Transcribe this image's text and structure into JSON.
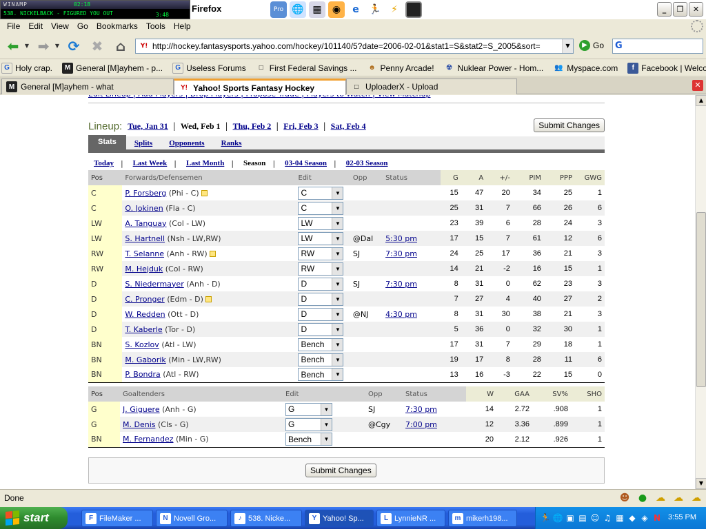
{
  "winamp": {
    "title": "WINAMP",
    "track": "538. NICKELBACK - FIGURED YOU OUT",
    "elapsed": "02:18",
    "length": "3:48"
  },
  "window": {
    "title": "Firefox"
  },
  "menu": [
    "File",
    "Edit",
    "View",
    "Go",
    "Bookmarks",
    "Tools",
    "Help"
  ],
  "nav": {
    "url": "http://hockey.fantasysports.yahoo.com/hockey/101140/5?date=2006-02-01&stat1=S&stat2=S_2005&sort=",
    "go_label": "Go"
  },
  "bookmarks": [
    {
      "label": "Holy crap.",
      "icon": "G"
    },
    {
      "label": "General [M]ayhem - p...",
      "icon": "M"
    },
    {
      "label": "Useless Forums",
      "icon": "G"
    },
    {
      "label": "First Federal Savings ...",
      "icon": "□"
    },
    {
      "label": "Penny Arcade!",
      "icon": "☻"
    },
    {
      "label": "Nuklear Power - Hom...",
      "icon": "☢"
    },
    {
      "label": "Myspace.com",
      "icon": "👥"
    },
    {
      "label": "Facebook | Welcome ...",
      "icon": "f"
    }
  ],
  "tabs": [
    {
      "label": "General [M]ayhem - what",
      "icon": "M"
    },
    {
      "label": "Yahoo! Sports Fantasy Hockey",
      "icon": "Y!"
    },
    {
      "label": "UploaderX - Upload",
      "icon": "□"
    }
  ],
  "page": {
    "top_links": "Edit Lineup  |  Add Players  |  Drop Players  |  Propose Trade  |  Players to Watch  |  View Matchup",
    "lineup_label": "Lineup:",
    "dates": [
      {
        "label": "Tue, Jan 31",
        "current": false
      },
      {
        "label": "Wed, Feb 1",
        "current": true
      },
      {
        "label": "Thu, Feb 2",
        "current": false
      },
      {
        "label": "Fri, Feb 3",
        "current": false
      },
      {
        "label": "Sat, Feb 4",
        "current": false
      }
    ],
    "submit_label": "Submit Changes",
    "subtabs": [
      {
        "label": "Stats",
        "active": true
      },
      {
        "label": "Splits",
        "active": false
      },
      {
        "label": "Opponents",
        "active": false
      },
      {
        "label": "Ranks",
        "active": false
      }
    ],
    "periods": [
      {
        "label": "Today",
        "current": false
      },
      {
        "label": "Last Week",
        "current": false
      },
      {
        "label": "Last Month",
        "current": false
      },
      {
        "label": "Season",
        "current": true
      },
      {
        "label": "03-04 Season",
        "current": false
      },
      {
        "label": "02-03 Season",
        "current": false
      }
    ],
    "skaters": {
      "headers": {
        "pos": "Pos",
        "name": "Forwards/Defensemen",
        "edit": "Edit",
        "opp": "Opp",
        "status": "Status",
        "stats": [
          "G",
          "A",
          "+/-",
          "PIM",
          "PPP",
          "GWG"
        ]
      },
      "rows": [
        {
          "pos": "C",
          "name": "P. Forsberg",
          "team": "(Phi - C)",
          "note": true,
          "edit": "C",
          "opp": "",
          "status": "",
          "stats": [
            "15",
            "47",
            "20",
            "34",
            "25",
            "1"
          ]
        },
        {
          "pos": "C",
          "name": "O. Jokinen",
          "team": "(Fla - C)",
          "note": false,
          "edit": "C",
          "opp": "",
          "status": "",
          "stats": [
            "25",
            "31",
            "7",
            "66",
            "26",
            "6"
          ]
        },
        {
          "pos": "LW",
          "name": "A. Tanguay",
          "team": "(Col - LW)",
          "note": false,
          "edit": "LW",
          "opp": "",
          "status": "",
          "stats": [
            "23",
            "39",
            "6",
            "28",
            "24",
            "3"
          ]
        },
        {
          "pos": "LW",
          "name": "S. Hartnell",
          "team": "(Nsh - LW,RW)",
          "note": false,
          "edit": "LW",
          "opp": "@Dal",
          "status": "5:30 pm",
          "stats": [
            "17",
            "15",
            "7",
            "61",
            "12",
            "6"
          ]
        },
        {
          "pos": "RW",
          "name": "T. Selanne",
          "team": "(Anh - RW)",
          "note": true,
          "edit": "RW",
          "opp": "SJ",
          "status": "7:30 pm",
          "stats": [
            "24",
            "25",
            "17",
            "36",
            "21",
            "3"
          ]
        },
        {
          "pos": "RW",
          "name": "M. Hejduk",
          "team": "(Col - RW)",
          "note": false,
          "edit": "RW",
          "opp": "",
          "status": "",
          "stats": [
            "14",
            "21",
            "-2",
            "16",
            "15",
            "1"
          ]
        },
        {
          "pos": "D",
          "name": "S. Niedermayer",
          "team": "(Anh - D)",
          "note": false,
          "edit": "D",
          "opp": "SJ",
          "status": "7:30 pm",
          "stats": [
            "8",
            "31",
            "0",
            "62",
            "23",
            "3"
          ]
        },
        {
          "pos": "D",
          "name": "C. Pronger",
          "team": "(Edm - D)",
          "note": true,
          "edit": "D",
          "opp": "",
          "status": "",
          "stats": [
            "7",
            "27",
            "4",
            "40",
            "27",
            "2"
          ]
        },
        {
          "pos": "D",
          "name": "W. Redden",
          "team": "(Ott - D)",
          "note": false,
          "edit": "D",
          "opp": "@NJ",
          "status": "4:30 pm",
          "stats": [
            "8",
            "31",
            "30",
            "38",
            "21",
            "3"
          ]
        },
        {
          "pos": "D",
          "name": "T. Kaberle",
          "team": "(Tor - D)",
          "note": false,
          "edit": "D",
          "opp": "",
          "status": "",
          "stats": [
            "5",
            "36",
            "0",
            "32",
            "30",
            "1"
          ]
        },
        {
          "pos": "BN",
          "name": "S. Kozlov",
          "team": "(Atl - LW)",
          "note": false,
          "edit": "Bench",
          "opp": "",
          "status": "",
          "stats": [
            "17",
            "31",
            "7",
            "29",
            "18",
            "1"
          ]
        },
        {
          "pos": "BN",
          "name": "M. Gaborik",
          "team": "(Min - LW,RW)",
          "note": false,
          "edit": "Bench",
          "opp": "",
          "status": "",
          "stats": [
            "19",
            "17",
            "8",
            "28",
            "11",
            "6"
          ]
        },
        {
          "pos": "BN",
          "name": "P. Bondra",
          "team": "(Atl - RW)",
          "note": false,
          "edit": "Bench",
          "opp": "",
          "status": "",
          "stats": [
            "13",
            "16",
            "-3",
            "22",
            "15",
            "0"
          ]
        }
      ]
    },
    "goalies": {
      "headers": {
        "pos": "Pos",
        "name": "Goaltenders",
        "edit": "Edit",
        "opp": "Opp",
        "status": "Status",
        "stats": [
          "W",
          "GAA",
          "SV%",
          "SHO"
        ]
      },
      "rows": [
        {
          "pos": "G",
          "name": "J. Giguere",
          "team": "(Anh - G)",
          "edit": "G",
          "opp": "SJ",
          "status": "7:30 pm",
          "stats": [
            "14",
            "2.72",
            ".908",
            "1"
          ]
        },
        {
          "pos": "G",
          "name": "M. Denis",
          "team": "(Cls - G)",
          "edit": "G",
          "opp": "@Cgy",
          "status": "7:00 pm",
          "stats": [
            "12",
            "3.36",
            ".899",
            "1"
          ]
        },
        {
          "pos": "BN",
          "name": "M. Fernandez",
          "team": "(Min - G)",
          "edit": "Bench",
          "opp": "",
          "status": "",
          "stats": [
            "20",
            "2.12",
            ".926",
            "1"
          ]
        }
      ]
    }
  },
  "statusbar": {
    "text": "Done"
  },
  "taskbar": {
    "start": "start",
    "tasks": [
      {
        "label": "FileMaker ...",
        "icon": "F",
        "active": false
      },
      {
        "label": "Novell Gro...",
        "icon": "N",
        "active": false
      },
      {
        "label": "538. Nicke...",
        "icon": "♪",
        "active": false
      },
      {
        "label": "Yahoo! Sp...",
        "icon": "Y",
        "active": true
      },
      {
        "label": "LynnieNR ...",
        "icon": "L",
        "active": false
      },
      {
        "label": "mikerh198...",
        "icon": "m",
        "active": false
      }
    ],
    "clock": "3:55 PM"
  }
}
